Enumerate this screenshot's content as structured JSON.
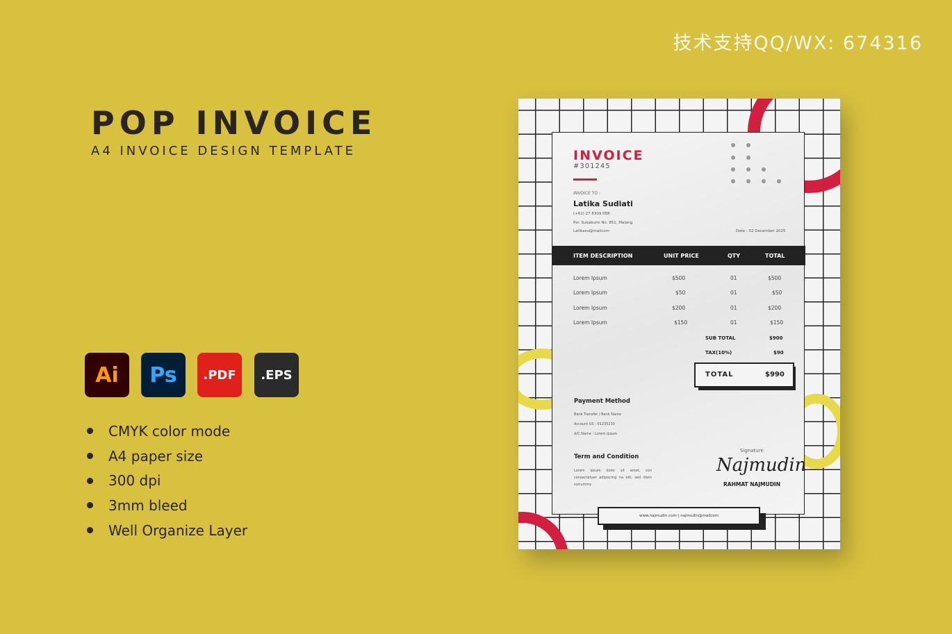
{
  "watermark": "技术支持QQ/WX: 674316",
  "title": "POP INVOICE",
  "subtitle": "A4 INVOICE DESIGN TEMPLATE",
  "formats": [
    {
      "label": "Ai",
      "bg": "#330000",
      "fg": "#ff9a00"
    },
    {
      "label": "Ps",
      "bg": "#001e36",
      "fg": "#31a8ff"
    },
    {
      "label": ".PDF",
      "bg": "#e0201b",
      "fg": "#ffffff"
    },
    {
      "label": ".EPS",
      "bg": "#2b2b2b",
      "fg": "#ffffff"
    }
  ],
  "features": [
    "CMYK color mode",
    "A4 paper size",
    "300 dpi",
    "3mm bleed",
    "Well Organize Layer"
  ],
  "invoice": {
    "heading": "INVOICE",
    "number": "#301245",
    "to_label": "INVOICE TO :",
    "name": "Latika Sudiati",
    "phone": "(+62) 27 8309 088",
    "address": "Psr. Sukabumi No. 851, Malang",
    "email": "Latikasu@mailcom",
    "date": "Date : 02 December 2025",
    "columns": [
      "ITEM DESCRIPTION",
      "UNIT PRICE",
      "QTY",
      "TOTAL"
    ],
    "items": [
      [
        "Lorem Ipsum",
        "$500",
        "01",
        "$500"
      ],
      [
        "Lorem Ipsum",
        "$50",
        "01",
        "$50"
      ],
      [
        "Lorem Ipsum",
        "$200",
        "01",
        "$200"
      ],
      [
        "Lorem Ipsum",
        "$150",
        "01",
        "$150"
      ]
    ],
    "subtotal_label": "SUB TOTAL",
    "subtotal": "$900",
    "tax_label": "TAX(10%)",
    "tax": "$90",
    "total_label": "TOTAL",
    "total": "$990",
    "payment_title": "Payment Method",
    "payment_lines": [
      "Bank Transfer / Bank Name",
      "Account US : 01235230",
      "A/C Name : Lorem ipsum"
    ],
    "terms_title": "Term and Condition",
    "terms": "Lorem ipsum dolor sit amet, con consectetuer adipiscing na elit, sed diam nonummy",
    "signature_label": "Signature",
    "signature": "Najmudin",
    "signer": "RAHMAT NAJMUDIN",
    "footer": "www.najmudin.com | najmudin@mailcom",
    "accent": "#d31f3f",
    "yellow": "#e8d94a"
  }
}
